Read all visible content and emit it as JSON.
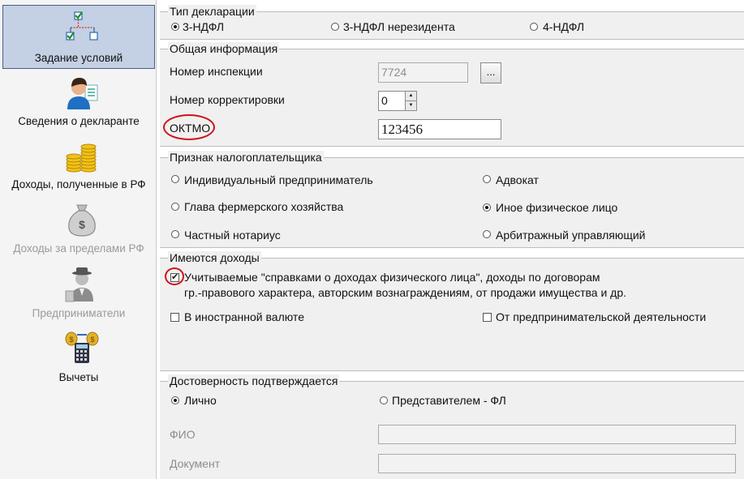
{
  "sidebar": {
    "items": [
      {
        "label": "Задание условий",
        "icon": "decision-tree-icon",
        "state": "active"
      },
      {
        "label": "Сведения о декларанте",
        "icon": "person-icon",
        "state": "normal"
      },
      {
        "label": "Доходы, полученные в РФ",
        "icon": "coins-icon",
        "state": "normal"
      },
      {
        "label": "Доходы за пределами РФ",
        "icon": "money-bag-icon",
        "state": "disabled"
      },
      {
        "label": "Предприниматели",
        "icon": "businessman-icon",
        "state": "disabled"
      },
      {
        "label": "Вычеты",
        "icon": "calculator-icon",
        "state": "normal"
      }
    ]
  },
  "declaration_type": {
    "title": "Тип декларации",
    "options": [
      "3-НДФЛ",
      "3-НДФЛ нерезидента",
      "4-НДФЛ"
    ],
    "selected": "3-НДФЛ"
  },
  "general_info": {
    "title": "Общая информация",
    "inspection_label": "Номер инспекции",
    "inspection_value": "7724",
    "browse_label": "...",
    "correction_label": "Номер корректировки",
    "correction_value": "0",
    "oktmo_label": "ОКТМО",
    "oktmo_value": "123456"
  },
  "taxpayer_sign": {
    "title": "Признак налогоплательщика",
    "options": [
      "Индивидуальный предприниматель",
      "Адвокат",
      "Глава фермерского хозяйства",
      "Иное физическое лицо",
      "Частный нотариус",
      "Арбитражный управляющий"
    ],
    "selected": "Иное физическое лицо"
  },
  "income": {
    "title": "Имеются доходы",
    "main_check_line1": "Учитываемые \"справками о доходах физического лица\", доходы по договорам",
    "main_check_line2": "гр.-правового характера, авторским вознаграждениям, от продажи имущества и др.",
    "main_checked": true,
    "foreign_currency_label": "В иностранной валюте",
    "foreign_currency_checked": false,
    "business_label": "От предпринимательской деятельности",
    "business_checked": false
  },
  "confirmation": {
    "title": "Достоверность подтверждается",
    "options": [
      "Лично",
      "Представителем - ФЛ"
    ],
    "selected": "Лично",
    "fio_label": "ФИО",
    "document_label": "Документ"
  },
  "colors": {
    "highlight": "#d0101a",
    "active_nav": "#c4d0e3"
  }
}
